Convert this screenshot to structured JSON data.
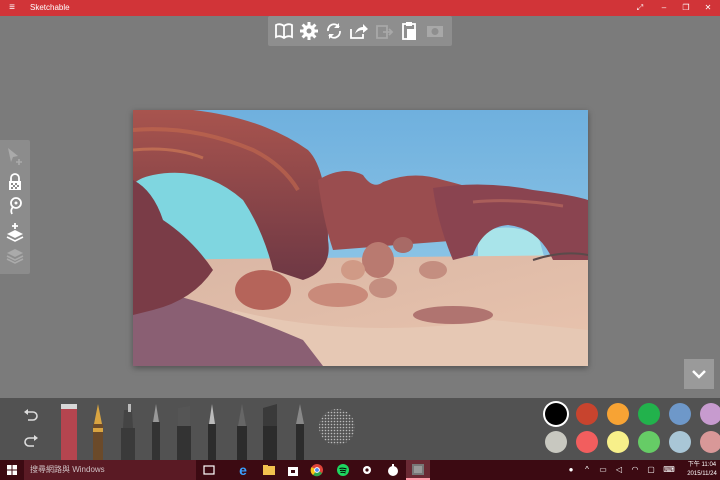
{
  "window": {
    "title": "Sketchable",
    "menu_icon": "hamburger-icon",
    "controls": [
      "fullscreen-icon",
      "minimize-icon",
      "maximize-icon",
      "close-icon"
    ]
  },
  "top_toolbar": {
    "icons": [
      "book-icon",
      "gear-icon",
      "sync-icon",
      "share-icon",
      "export-icon",
      "clipboard-icon",
      "camera-icon"
    ]
  },
  "left_toolbar": {
    "icons": [
      "select-add-icon",
      "lock-icon",
      "lasso-icon",
      "layer-add-icon",
      "layers-icon"
    ]
  },
  "bottom_toolbar": {
    "undo_icon": "undo-icon",
    "redo_icon": "redo-icon",
    "tools": [
      "eraser",
      "fountain-pen",
      "marker",
      "brush",
      "wide-pen",
      "fine-pen",
      "calligraphy-pen",
      "chisel-marker",
      "pencil",
      "texture-brush"
    ],
    "colors": {
      "row1": [
        "#000000",
        "#c8442e",
        "#f7a334",
        "#22b24c",
        "#6e98c9",
        "#c79bcf"
      ],
      "row2": [
        "#c8c8c0",
        "#f25e5e",
        "#f7f08a",
        "#66cc66",
        "#a9c6d6",
        "#d99898"
      ],
      "selected": "#000000"
    }
  },
  "taskbar": {
    "search_placeholder": "搜尋網路與 Windows",
    "time": "下午 11:04",
    "date": "2015/11/24"
  },
  "colors": {
    "title_bar": "#d13438",
    "canvas_bg": "#7b7b7b",
    "toolbar_bg": "#525252",
    "taskbar_bg": "#3c0a12"
  }
}
